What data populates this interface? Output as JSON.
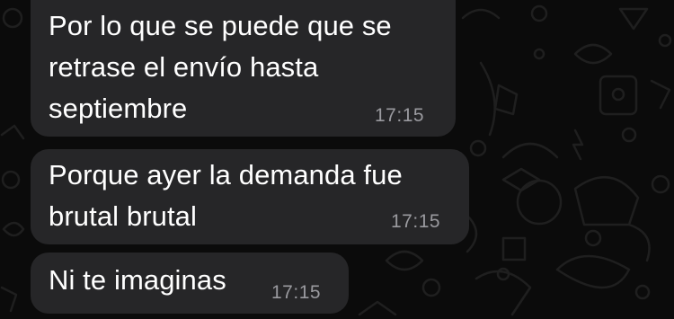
{
  "chat": {
    "messages": [
      {
        "text": "Por lo que se puede que se\nretrase el envío hasta\nseptiembre",
        "time": "17:15"
      },
      {
        "text": "Porque ayer la demanda fue\nbrutal brutal",
        "time": "17:15"
      },
      {
        "text": "Ni te imaginas",
        "time": "17:15"
      }
    ]
  },
  "colors": {
    "background": "#0b0b0b",
    "bubble": "#262628",
    "text": "#ffffff",
    "timestamp": "#9a9a9f"
  }
}
